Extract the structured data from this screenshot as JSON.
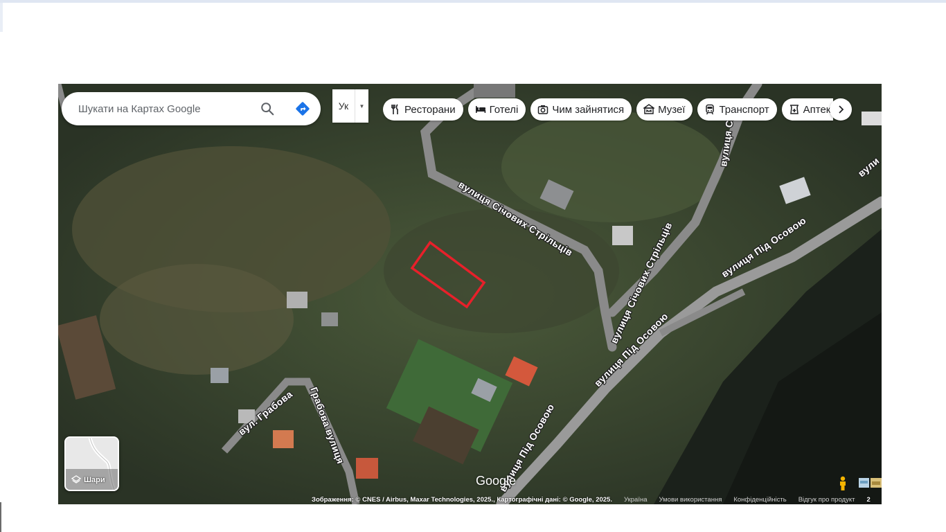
{
  "search": {
    "placeholder": "Шукати на Картах Google",
    "search_icon": "search-icon",
    "directions_icon": "directions-icon"
  },
  "language": {
    "label": "Ук"
  },
  "categories": [
    {
      "label": "Ресторани",
      "icon": "restaurant-icon"
    },
    {
      "label": "Готелі",
      "icon": "hotel-icon"
    },
    {
      "label": "Чим зайнятися",
      "icon": "camera-icon"
    },
    {
      "label": "Музеї",
      "icon": "museum-icon"
    },
    {
      "label": "Транспорт",
      "icon": "transit-icon"
    },
    {
      "label": "Аптеки",
      "icon": "pharmacy-icon"
    }
  ],
  "layers": {
    "label": "Шари"
  },
  "logo": "Google",
  "roads": {
    "sichovykh_1": "вулиця Січових Стрільців",
    "sichovykh_2": "вулиця Січових Стрільців",
    "sichovykh_3": "вулиця Січ",
    "pid_osovoyu_1": "вулиця Під Осовою",
    "pid_osovoyu_2": "вулиця Під Осовою",
    "pid_osovoyu_3": "вулиця Під Осовою",
    "pid_osovoyu_4": "вули",
    "grabova_1": "вул. Грабова",
    "grabova_2": "Грабова вулиця"
  },
  "attribution": {
    "imagery": "Зображення: © CNES / Airbus, Maxar Technologies, 2025., Картографічні дані: © Google, 2025.",
    "country": "Україна",
    "terms": "Умови використання",
    "privacy": "Конфіденційність",
    "feedback": "Відгук про продукт",
    "scale": "2"
  },
  "colors": {
    "highlight": "#e8202a",
    "road": "#8a8a8a",
    "directions_blue": "#1a73e8"
  }
}
